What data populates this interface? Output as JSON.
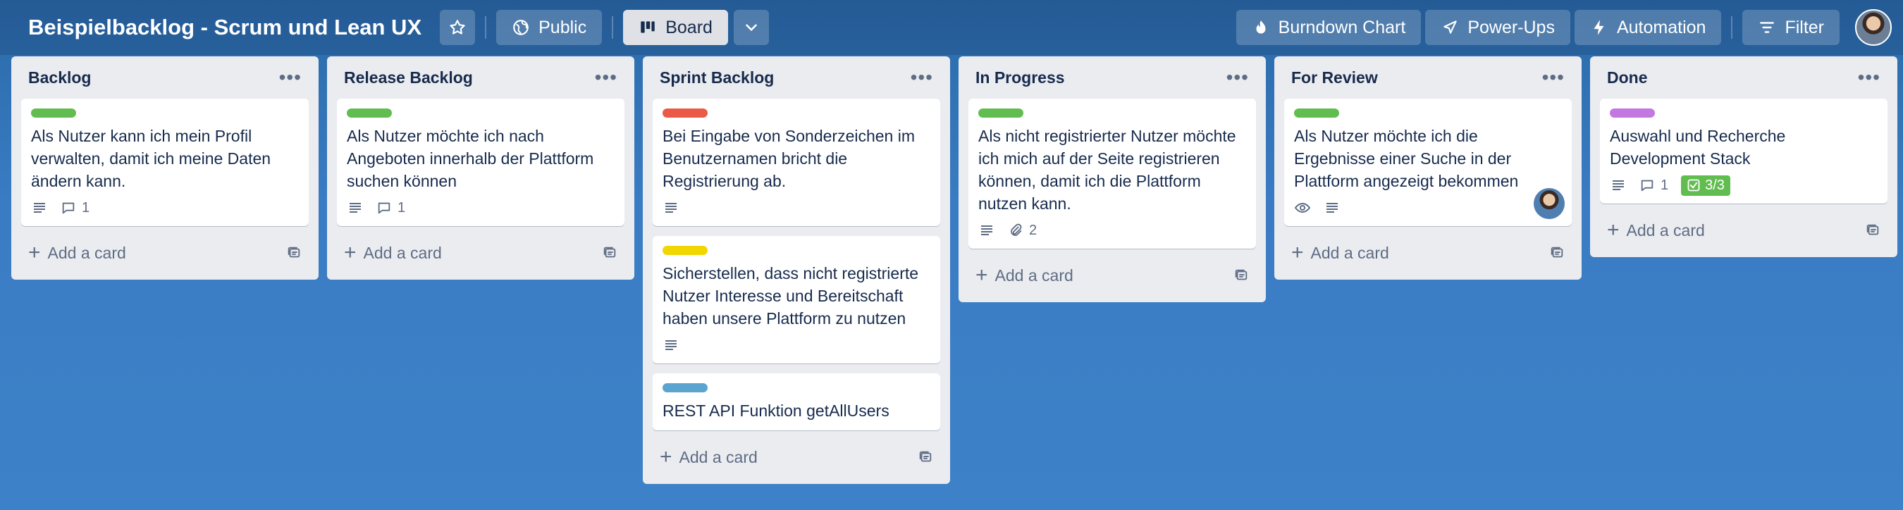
{
  "header": {
    "board_title": "Beispielbacklog - Scrum und Lean UX",
    "visibility_label": "Public",
    "view_label": "Board",
    "burndown_label": "Burndown Chart",
    "powerups_label": "Power-Ups",
    "automation_label": "Automation",
    "filter_label": "Filter"
  },
  "add_card_label": "Add a card",
  "lists": [
    {
      "title": "Backlog",
      "cards": [
        {
          "label_color": "#61bd4f",
          "text": "Als Nutzer kann ich mein Profil verwalten, damit ich meine Daten ändern kann.",
          "comments": "1"
        }
      ]
    },
    {
      "title": "Release Backlog",
      "cards": [
        {
          "label_color": "#61bd4f",
          "text": "Als Nutzer möchte ich nach Angeboten innerhalb der Plattform suchen können",
          "comments": "1"
        }
      ]
    },
    {
      "title": "Sprint Backlog",
      "cards": [
        {
          "label_color": "#eb5a46",
          "text": "Bei Eingabe von Sonderzeichen im Benutzernamen bricht die Registrierung ab."
        },
        {
          "label_color": "#f2d600",
          "text": "Sicherstellen, dass nicht registrierte Nutzer Interesse und Bereitschaft haben unsere Plattform zu nutzen"
        },
        {
          "label_color": "#5ba4cf",
          "text": "REST API Funktion getAllUsers"
        }
      ]
    },
    {
      "title": "In Progress",
      "cards": [
        {
          "label_color": "#61bd4f",
          "text": "Als nicht registrierter Nutzer möchte ich mich auf der Seite registrieren können, damit ich die Plattform nutzen kann.",
          "attachments": "2"
        }
      ]
    },
    {
      "title": "For Review",
      "cards": [
        {
          "label_color": "#61bd4f",
          "text": "Als Nutzer möchte ich die Ergebnisse einer Suche in der Plattform angezeigt bekommen"
        }
      ]
    },
    {
      "title": "Done",
      "cards": [
        {
          "label_color": "#c377e0",
          "text": "Auswahl und Recherche Development Stack",
          "comments": "1",
          "checklist": "3/3"
        }
      ]
    }
  ],
  "icons": {
    "star": "star-icon",
    "globe": "globe-icon",
    "board": "board-icon",
    "chevron": "chevron-down-icon",
    "burndown": "flame-icon",
    "powerups": "rocket-icon",
    "automation": "bolt-icon",
    "filter": "filter-icon",
    "description": "description-icon",
    "comment": "comment-icon",
    "attachment": "paperclip-icon",
    "watch": "eye-icon",
    "checklist": "checkbox-icon",
    "template": "card-template-icon",
    "more": "more-dots-icon",
    "plus": "plus-icon"
  }
}
